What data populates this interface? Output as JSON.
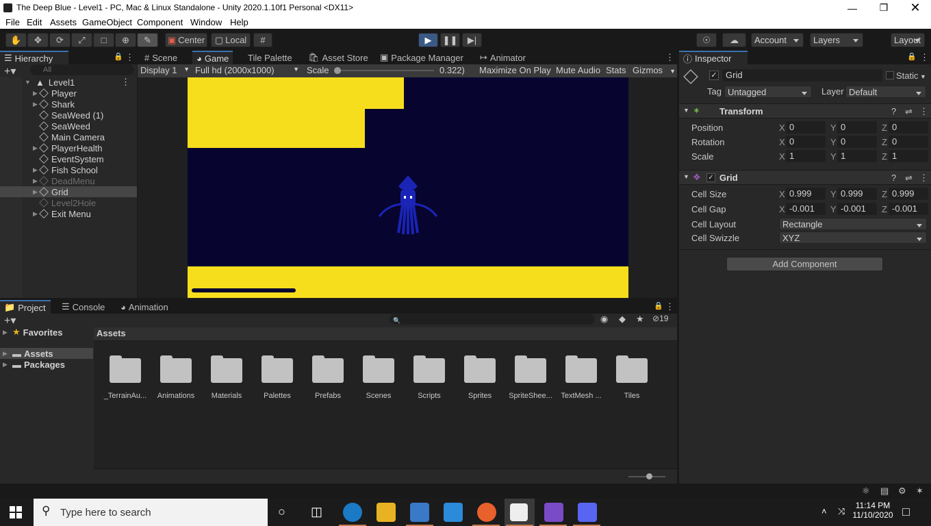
{
  "window": {
    "title": "The Deep Blue - Level1 - PC, Mac & Linux Standalone - Unity 2020.1.10f1 Personal <DX11>"
  },
  "menu": [
    "File",
    "Edit",
    "Assets",
    "GameObject",
    "Component",
    "Window",
    "Help"
  ],
  "toolbar": {
    "pivot": "Center",
    "space": "Local",
    "account": "Account",
    "layers": "Layers",
    "layout": "Layout"
  },
  "hierarchy": {
    "tab": "Hierarchy",
    "search_placeholder": "All",
    "scene": "Level1",
    "items": [
      {
        "name": "Player",
        "arrow": true,
        "dim": false
      },
      {
        "name": "Shark",
        "arrow": true,
        "dim": false
      },
      {
        "name": "SeaWeed (1)",
        "arrow": false,
        "dim": false
      },
      {
        "name": "SeaWeed",
        "arrow": false,
        "dim": false
      },
      {
        "name": "Main Camera",
        "arrow": false,
        "dim": false
      },
      {
        "name": "PlayerHealth",
        "arrow": true,
        "dim": false
      },
      {
        "name": "EventSystem",
        "arrow": false,
        "dim": false
      },
      {
        "name": "Fish School",
        "arrow": true,
        "dim": false
      },
      {
        "name": "DeadMenu",
        "arrow": true,
        "dim": true
      },
      {
        "name": "Grid",
        "arrow": true,
        "dim": false,
        "selected": true
      },
      {
        "name": "Level2Hole",
        "arrow": false,
        "dim": true
      },
      {
        "name": "Exit Menu",
        "arrow": true,
        "dim": false
      }
    ]
  },
  "center_tabs": [
    "Scene",
    "Game",
    "Tile Palette",
    "Asset Store",
    "Package Manager",
    "Animator"
  ],
  "game_bar": {
    "display": "Display 1",
    "resolution": "Full hd (2000x1000)",
    "scale_label": "Scale",
    "scale_value": "0.322)",
    "maximize": "Maximize On Play",
    "mute": "Mute Audio",
    "stats": "Stats",
    "gizmos": "Gizmos"
  },
  "inspector": {
    "tab": "Inspector",
    "object_name": "Grid",
    "static": "Static",
    "tag_label": "Tag",
    "tag": "Untagged",
    "layer_label": "Layer",
    "layer": "Default",
    "transform": {
      "title": "Transform",
      "rows": [
        {
          "label": "Position",
          "x": "0",
          "y": "0",
          "z": "0"
        },
        {
          "label": "Rotation",
          "x": "0",
          "y": "0",
          "z": "0"
        },
        {
          "label": "Scale",
          "x": "1",
          "y": "1",
          "z": "1"
        }
      ]
    },
    "grid": {
      "title": "Grid",
      "cell_size_label": "Cell Size",
      "cell_size": {
        "x": "0.999",
        "y": "0.999",
        "z": "0.999"
      },
      "cell_gap_label": "Cell Gap",
      "cell_gap": {
        "x": "-0.001",
        "y": "-0.001",
        "z": "-0.001"
      },
      "cell_layout_label": "Cell Layout",
      "cell_layout": "Rectangle",
      "cell_swizzle_label": "Cell Swizzle",
      "cell_swizzle": "XYZ"
    },
    "add_component": "Add Component"
  },
  "bottom_tabs": [
    "Project",
    "Console",
    "Animation"
  ],
  "project": {
    "favorites": "Favorites",
    "assets": "Assets",
    "packages": "Packages",
    "breadcrumb": "Assets",
    "hidden_count": "19",
    "folders": [
      "_TerrainAu...",
      "Animations",
      "Materials",
      "Palettes",
      "Prefabs",
      "Scenes",
      "Scripts",
      "Sprites",
      "SpriteShee...",
      "TextMesh ...",
      "Tiles"
    ]
  },
  "taskbar": {
    "search": "Type here to search",
    "time": "11:14 PM",
    "date": "11/10/2020"
  },
  "colors": {
    "sand": "#f7de1c",
    "water": "#07052f",
    "squid": "#1a24b6",
    "play": "#3a5a85"
  }
}
